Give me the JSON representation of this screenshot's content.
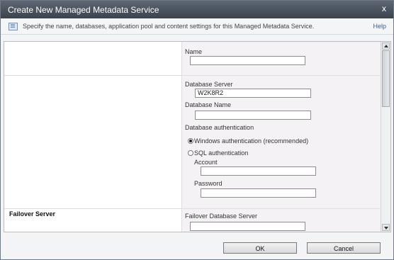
{
  "dialog": {
    "title": "Create New Managed Metadata Service",
    "close_glyph": "x",
    "description": "Specify the name, databases, application pool and content settings for this Managed Metadata Service.",
    "help_label": "Help"
  },
  "form": {
    "name_label": "Name",
    "name_value": "",
    "db_server_label": "Database Server",
    "db_server_value": "W2K8R2",
    "db_name_label": "Database Name",
    "db_name_value": "",
    "db_auth_label": "Database authentication",
    "auth_windows_label": "Windows authentication (recommended)",
    "auth_sql_label": "SQL authentication",
    "account_label": "Account",
    "account_value": "",
    "password_label": "Password",
    "password_value": "",
    "failover_section_title": "Failover Server",
    "failover_db_server_label": "Failover Database Server",
    "failover_db_server_value": ""
  },
  "buttons": {
    "ok_label": "OK",
    "cancel_label": "Cancel"
  },
  "icons": {
    "info": "info-icon",
    "close": "close-icon"
  }
}
